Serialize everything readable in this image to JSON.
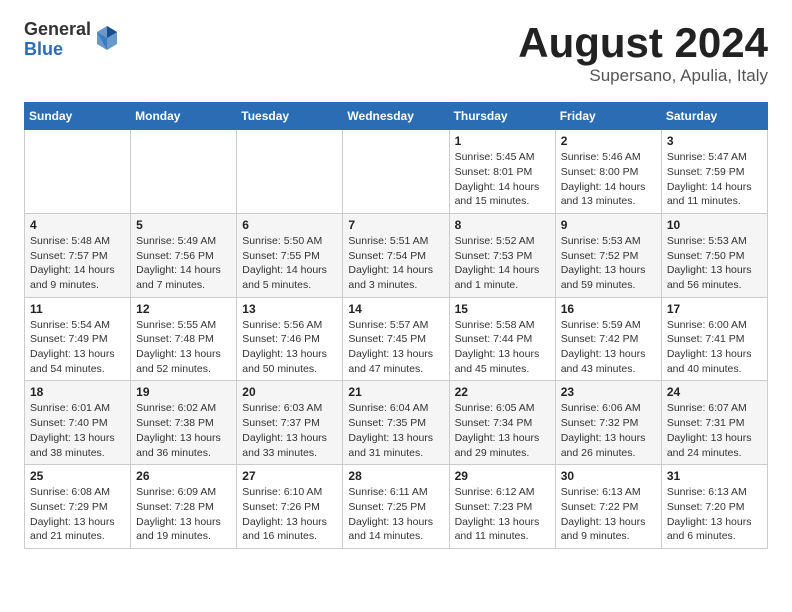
{
  "header": {
    "logo_general": "General",
    "logo_blue": "Blue",
    "title": "August 2024",
    "location": "Supersano, Apulia, Italy"
  },
  "days_of_week": [
    "Sunday",
    "Monday",
    "Tuesday",
    "Wednesday",
    "Thursday",
    "Friday",
    "Saturday"
  ],
  "weeks": [
    [
      {
        "day": "",
        "info": ""
      },
      {
        "day": "",
        "info": ""
      },
      {
        "day": "",
        "info": ""
      },
      {
        "day": "",
        "info": ""
      },
      {
        "day": "1",
        "info": "Sunrise: 5:45 AM\nSunset: 8:01 PM\nDaylight: 14 hours and 15 minutes."
      },
      {
        "day": "2",
        "info": "Sunrise: 5:46 AM\nSunset: 8:00 PM\nDaylight: 14 hours and 13 minutes."
      },
      {
        "day": "3",
        "info": "Sunrise: 5:47 AM\nSunset: 7:59 PM\nDaylight: 14 hours and 11 minutes."
      }
    ],
    [
      {
        "day": "4",
        "info": "Sunrise: 5:48 AM\nSunset: 7:57 PM\nDaylight: 14 hours and 9 minutes."
      },
      {
        "day": "5",
        "info": "Sunrise: 5:49 AM\nSunset: 7:56 PM\nDaylight: 14 hours and 7 minutes."
      },
      {
        "day": "6",
        "info": "Sunrise: 5:50 AM\nSunset: 7:55 PM\nDaylight: 14 hours and 5 minutes."
      },
      {
        "day": "7",
        "info": "Sunrise: 5:51 AM\nSunset: 7:54 PM\nDaylight: 14 hours and 3 minutes."
      },
      {
        "day": "8",
        "info": "Sunrise: 5:52 AM\nSunset: 7:53 PM\nDaylight: 14 hours and 1 minute."
      },
      {
        "day": "9",
        "info": "Sunrise: 5:53 AM\nSunset: 7:52 PM\nDaylight: 13 hours and 59 minutes."
      },
      {
        "day": "10",
        "info": "Sunrise: 5:53 AM\nSunset: 7:50 PM\nDaylight: 13 hours and 56 minutes."
      }
    ],
    [
      {
        "day": "11",
        "info": "Sunrise: 5:54 AM\nSunset: 7:49 PM\nDaylight: 13 hours and 54 minutes."
      },
      {
        "day": "12",
        "info": "Sunrise: 5:55 AM\nSunset: 7:48 PM\nDaylight: 13 hours and 52 minutes."
      },
      {
        "day": "13",
        "info": "Sunrise: 5:56 AM\nSunset: 7:46 PM\nDaylight: 13 hours and 50 minutes."
      },
      {
        "day": "14",
        "info": "Sunrise: 5:57 AM\nSunset: 7:45 PM\nDaylight: 13 hours and 47 minutes."
      },
      {
        "day": "15",
        "info": "Sunrise: 5:58 AM\nSunset: 7:44 PM\nDaylight: 13 hours and 45 minutes."
      },
      {
        "day": "16",
        "info": "Sunrise: 5:59 AM\nSunset: 7:42 PM\nDaylight: 13 hours and 43 minutes."
      },
      {
        "day": "17",
        "info": "Sunrise: 6:00 AM\nSunset: 7:41 PM\nDaylight: 13 hours and 40 minutes."
      }
    ],
    [
      {
        "day": "18",
        "info": "Sunrise: 6:01 AM\nSunset: 7:40 PM\nDaylight: 13 hours and 38 minutes."
      },
      {
        "day": "19",
        "info": "Sunrise: 6:02 AM\nSunset: 7:38 PM\nDaylight: 13 hours and 36 minutes."
      },
      {
        "day": "20",
        "info": "Sunrise: 6:03 AM\nSunset: 7:37 PM\nDaylight: 13 hours and 33 minutes."
      },
      {
        "day": "21",
        "info": "Sunrise: 6:04 AM\nSunset: 7:35 PM\nDaylight: 13 hours and 31 minutes."
      },
      {
        "day": "22",
        "info": "Sunrise: 6:05 AM\nSunset: 7:34 PM\nDaylight: 13 hours and 29 minutes."
      },
      {
        "day": "23",
        "info": "Sunrise: 6:06 AM\nSunset: 7:32 PM\nDaylight: 13 hours and 26 minutes."
      },
      {
        "day": "24",
        "info": "Sunrise: 6:07 AM\nSunset: 7:31 PM\nDaylight: 13 hours and 24 minutes."
      }
    ],
    [
      {
        "day": "25",
        "info": "Sunrise: 6:08 AM\nSunset: 7:29 PM\nDaylight: 13 hours and 21 minutes."
      },
      {
        "day": "26",
        "info": "Sunrise: 6:09 AM\nSunset: 7:28 PM\nDaylight: 13 hours and 19 minutes."
      },
      {
        "day": "27",
        "info": "Sunrise: 6:10 AM\nSunset: 7:26 PM\nDaylight: 13 hours and 16 minutes."
      },
      {
        "day": "28",
        "info": "Sunrise: 6:11 AM\nSunset: 7:25 PM\nDaylight: 13 hours and 14 minutes."
      },
      {
        "day": "29",
        "info": "Sunrise: 6:12 AM\nSunset: 7:23 PM\nDaylight: 13 hours and 11 minutes."
      },
      {
        "day": "30",
        "info": "Sunrise: 6:13 AM\nSunset: 7:22 PM\nDaylight: 13 hours and 9 minutes."
      },
      {
        "day": "31",
        "info": "Sunrise: 6:13 AM\nSunset: 7:20 PM\nDaylight: 13 hours and 6 minutes."
      }
    ]
  ]
}
